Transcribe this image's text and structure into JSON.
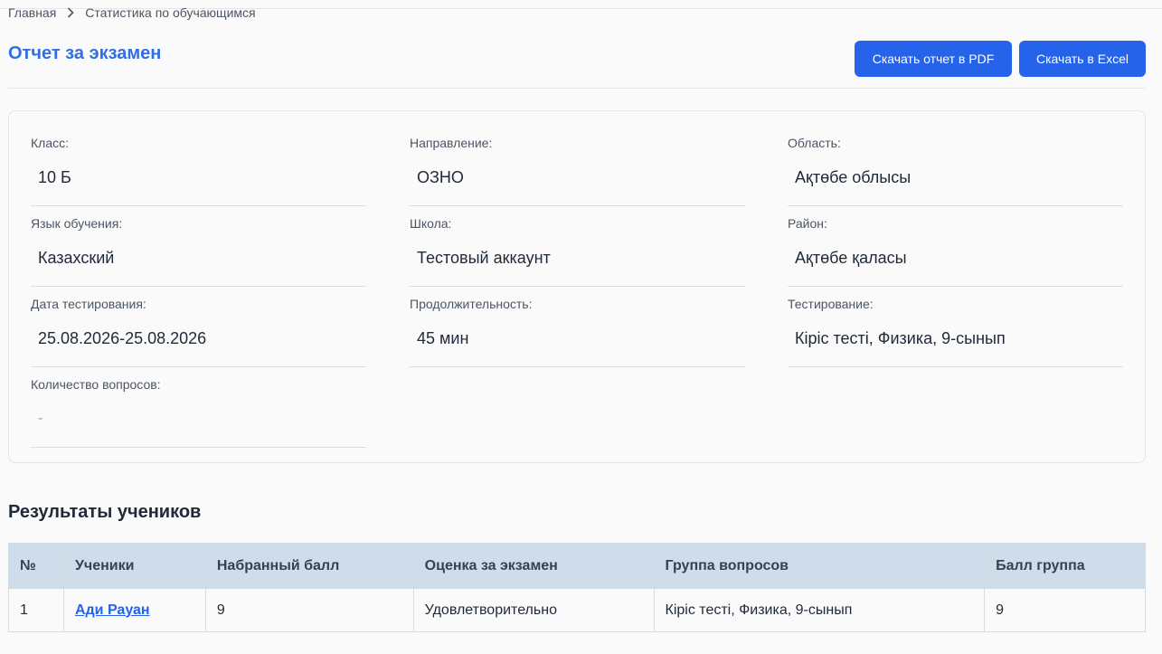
{
  "breadcrumb": {
    "home": "Главная",
    "current": "Статистика по обучающимся"
  },
  "page": {
    "title": "Отчет за экзамен"
  },
  "actions": {
    "pdf_label": "Скачать отчет в PDF",
    "excel_label": "Скачать в Excel"
  },
  "info": {
    "class_label": "Класс:",
    "class_value": "10 Б",
    "direction_label": "Направление:",
    "direction_value": "ОЗНО",
    "region_label": "Область:",
    "region_value": "Ақтөбе облысы",
    "language_label": "Язык обучения:",
    "language_value": "Казахский",
    "school_label": "Школа:",
    "school_value": "Тестовый аккаунт",
    "district_label": "Район:",
    "district_value": "Ақтөбе қаласы",
    "date_label": "Дата тестирования:",
    "date_value": "25.08.2026-25.08.2026",
    "duration_label": "Продолжительность:",
    "duration_value": "45 мин",
    "testing_label": "Тестирование:",
    "testing_value": "Кіріс тесті, Физика, 9-сынып",
    "questions_label": "Количество вопросов:",
    "questions_value": "-"
  },
  "results": {
    "title": "Результаты учеников",
    "columns": [
      "№",
      "Ученики",
      "Набранный балл",
      "Оценка за экзамен",
      "Группа вопросов",
      "Балл группа"
    ],
    "rows": [
      {
        "num": "1",
        "student": "Ади Рауан",
        "score": "9",
        "grade": "Удовлетворительно",
        "group": "Кіріс тесті, Физика, 9-сынып",
        "group_score": "9"
      }
    ]
  },
  "colors": {
    "accent": "#2563eb",
    "title": "#2f6fe6",
    "table_header_bg": "#cfdcea"
  },
  "icons": {
    "breadcrumb_separator": "chevron-right-icon"
  }
}
